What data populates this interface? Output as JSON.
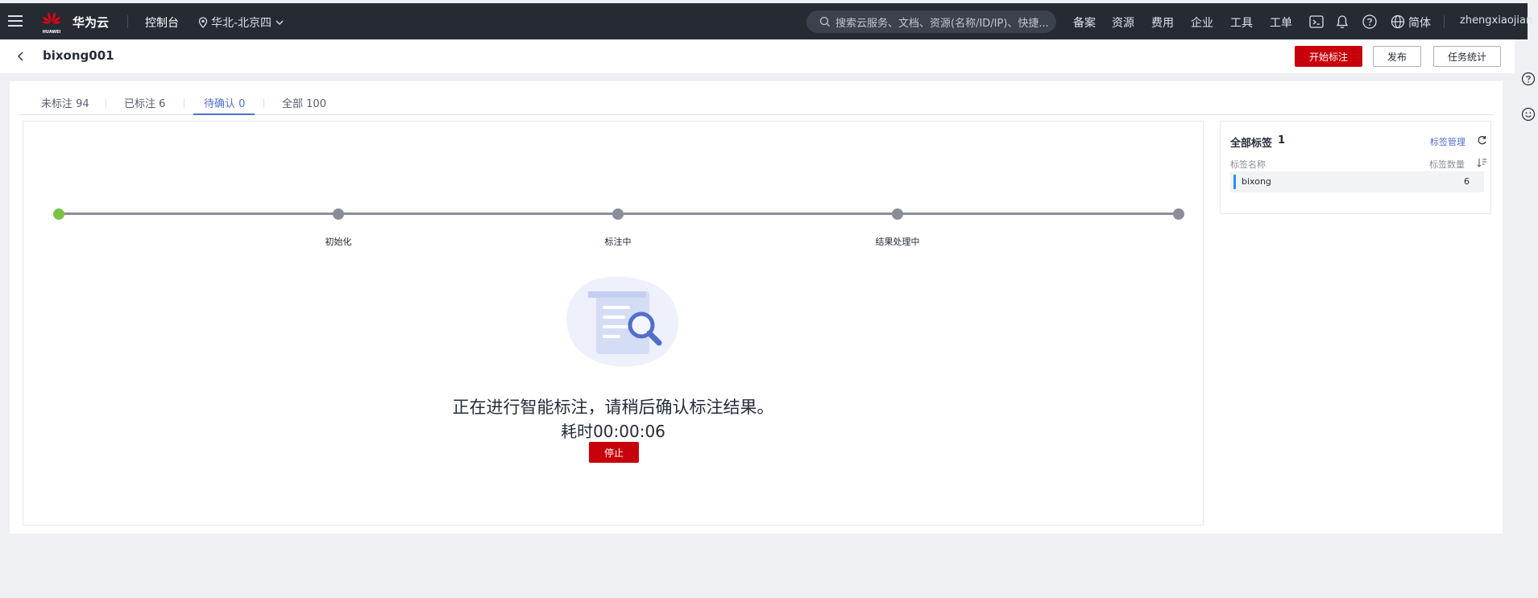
{
  "topbar": {
    "brand_logo_text": "HUAWEI",
    "brand": "华为云",
    "console": "控制台",
    "region": "华北-北京四",
    "search_placeholder": "搜索云服务、文档、资源(名称/ID/IP)、快捷...",
    "nav": [
      "备案",
      "资源",
      "费用",
      "企业",
      "工具",
      "工单"
    ],
    "language": "简体",
    "user": "zhengxiaojian"
  },
  "header": {
    "title": "bixong001",
    "start_label": "开始标注",
    "publish_label": "发布",
    "stats_label": "任务统计"
  },
  "tabs": [
    {
      "label": "未标注",
      "count": "94"
    },
    {
      "label": "已标注",
      "count": "6"
    },
    {
      "label": "待确认",
      "count": "0"
    },
    {
      "label": "全部",
      "count": "100"
    }
  ],
  "progress": {
    "steps": [
      "初始化",
      "标注中",
      "结果处理中"
    ],
    "completed_steps": 1
  },
  "status": {
    "message": "正在进行智能标注，请稍后确认标注结果。",
    "elapsed": "耗时00:00:06",
    "stop_label": "停止"
  },
  "labels_panel": {
    "title": "全部标签",
    "count": "1",
    "manage_label": "标签管理",
    "col_name": "标签名称",
    "col_count": "标签数量",
    "items": [
      {
        "name": "bixong",
        "count": "6",
        "color": "#2b8ef0"
      }
    ]
  },
  "colors": {
    "topbar_bg": "#252a33",
    "primary_red": "#c7000b",
    "accent_blue": "#526ecc",
    "step_done": "#7ec148",
    "step_pending": "#8a8e99"
  }
}
